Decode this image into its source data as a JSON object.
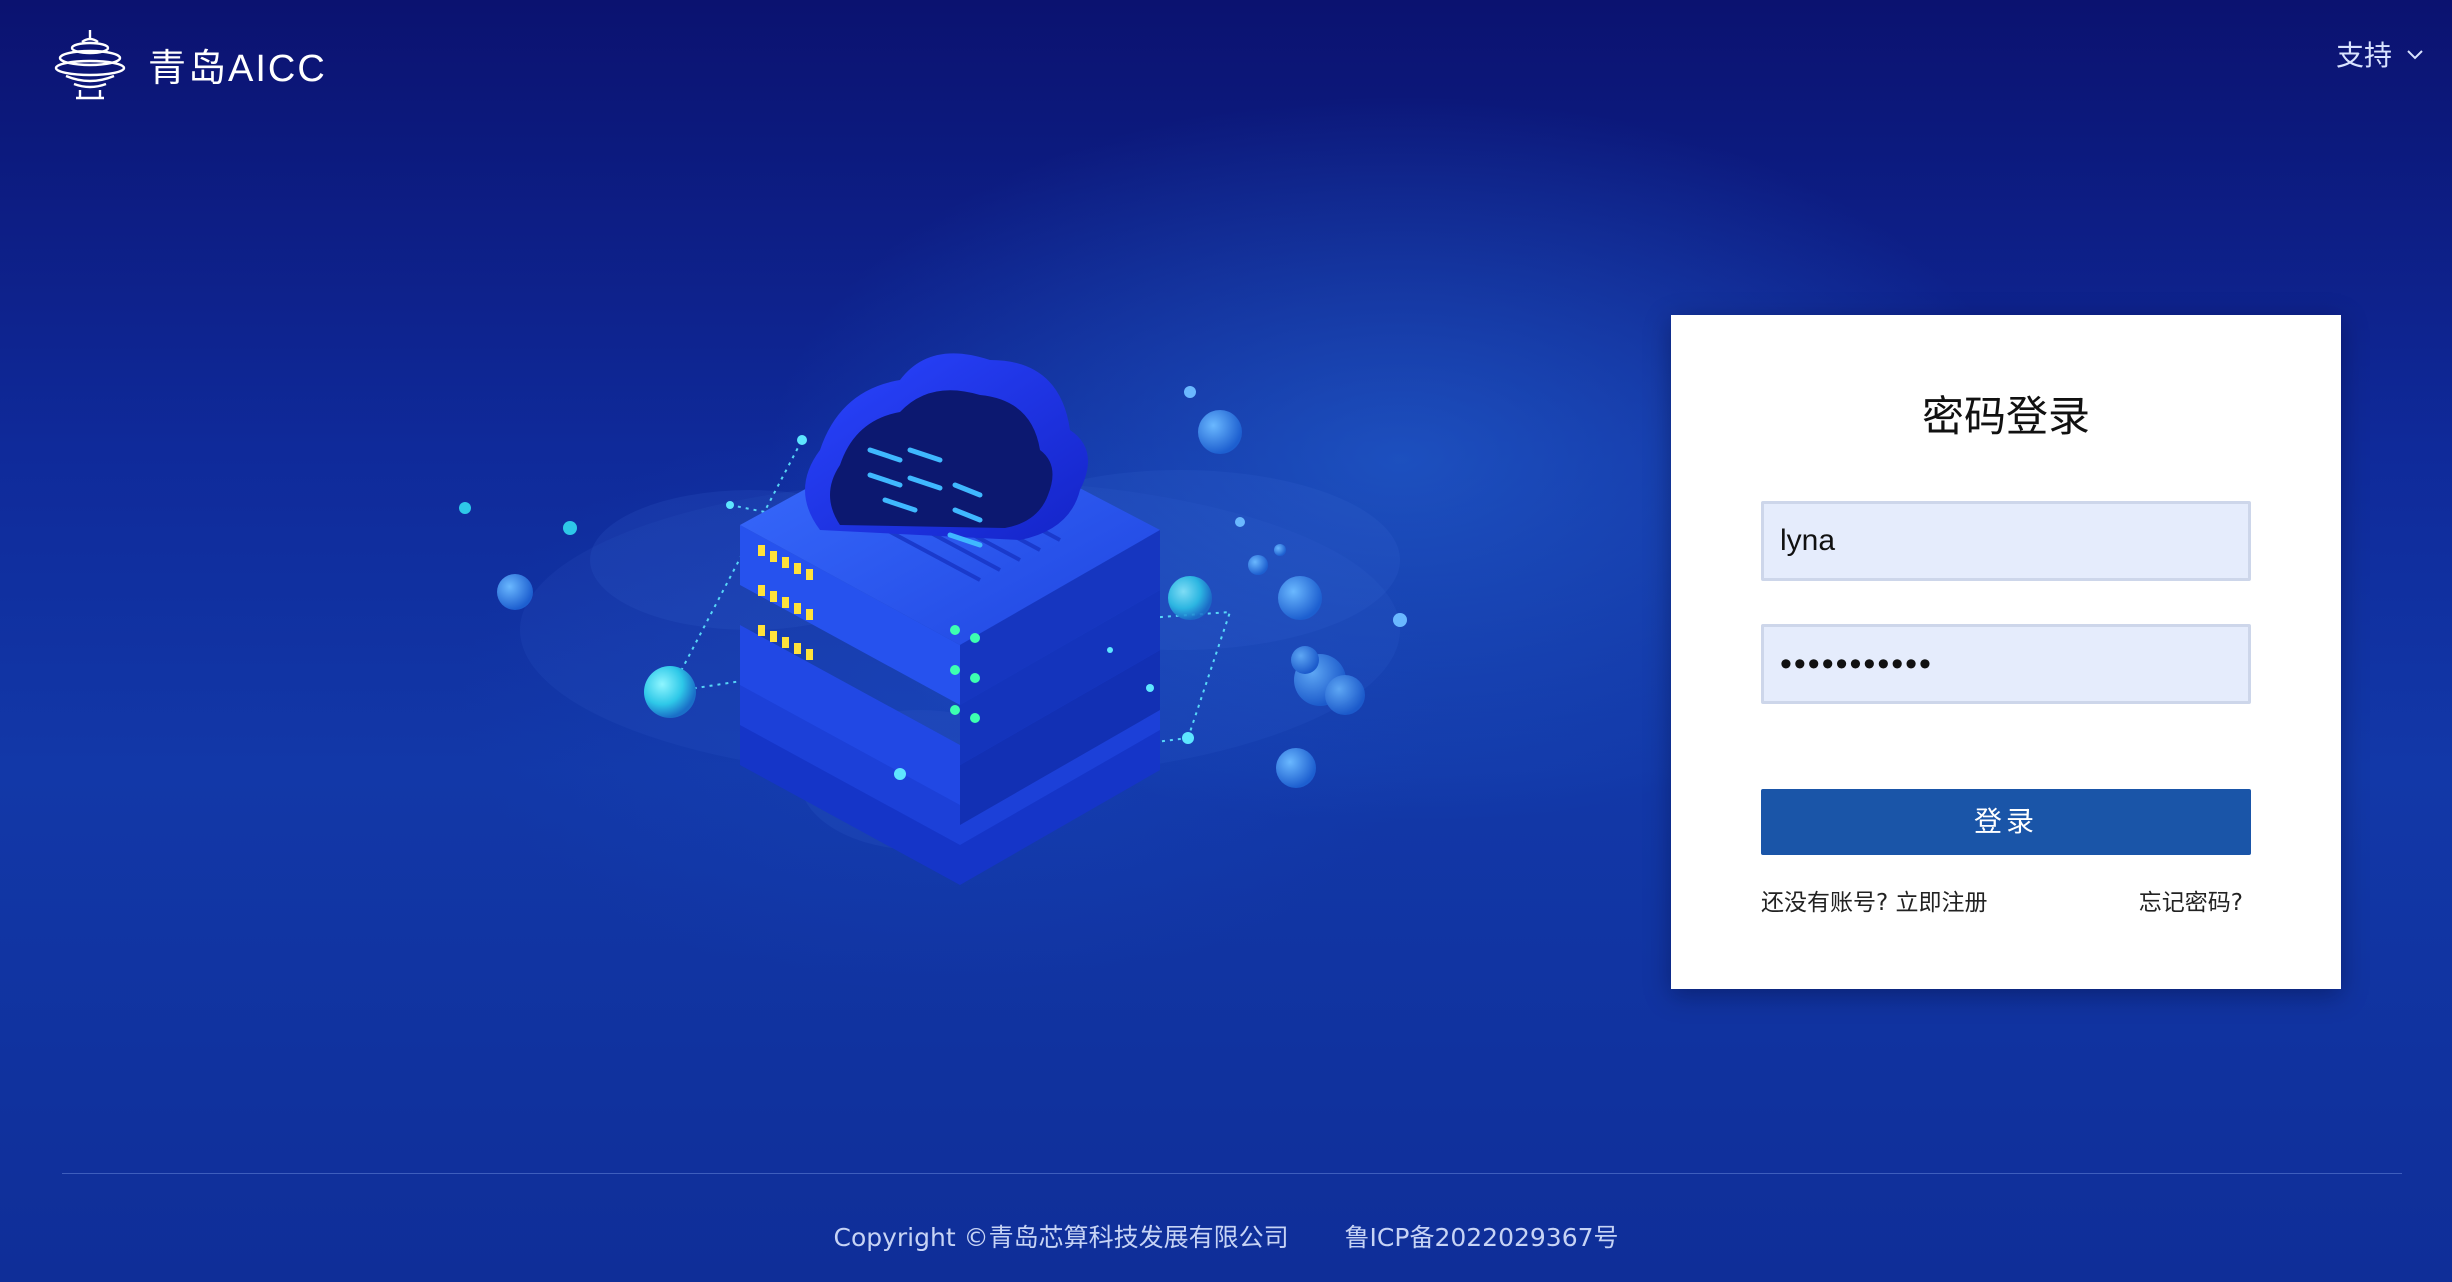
{
  "header": {
    "logo_text": "青岛AICC",
    "support_label": "支持"
  },
  "login": {
    "title": "密码登录",
    "username_value": "lyna",
    "password_masked": "•••••••••••",
    "submit_label": "登录",
    "register_text": "还没有账号? 立即注册",
    "forgot_text": "忘记密码?"
  },
  "footer": {
    "copyright": "Copyright ©青岛芯算科技发展有限公司",
    "icp": "鲁ICP备2022029367号"
  },
  "colors": {
    "background": "#0f2a9a",
    "button": "#1a55a8",
    "input_bg": "#e5ecfc"
  },
  "icons": {
    "logo": "tower-logo-icon",
    "dropdown": "chevron-down-icon"
  }
}
